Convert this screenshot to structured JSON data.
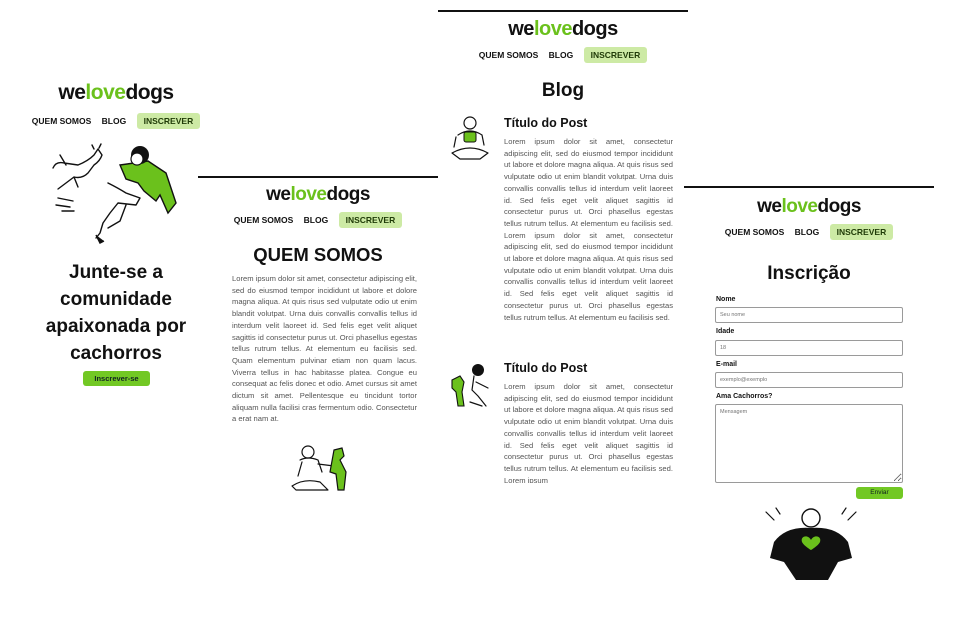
{
  "brand": {
    "prefix": "we",
    "accent": "love",
    "suffix": "dogs",
    "accent_color": "#6bc11c"
  },
  "nav": {
    "about": "QUEM SOMOS",
    "blog": "BLOG",
    "signup": "INSCREVER"
  },
  "home": {
    "headline": "Junte-se a comunidade apaixonada por cachorros",
    "cta": "Inscrever-se"
  },
  "about": {
    "title": "QUEM SOMOS",
    "text": "Lorem ipsum dolor sit amet, consectetur adipiscing elit, sed do eiusmod tempor incididunt ut labore et dolore magna aliqua. At quis risus sed vulputate odio ut enim blandit volutpat. Urna duis convallis convallis tellus id interdum velit laoreet id. Sed felis eget velit aliquet sagittis id consectetur purus ut. Orci phasellus egestas tellus rutrum tellus. At elementum eu facilisis sed. Quam elementum pulvinar etiam non quam lacus. Viverra tellus in hac habitasse platea. Congue eu consequat ac felis donec et odio. Amet cursus sit amet dictum sit amet. Pellentesque eu tincidunt tortor aliquam nulla facilisi cras fermentum odio. Consectetur a erat nam at."
  },
  "blog": {
    "title": "Blog",
    "posts": [
      {
        "title": "Título do Post",
        "text": "Lorem ipsum dolor sit amet, consectetur adipiscing elit, sed do eiusmod tempor incididunt ut labore et dolore magna aliqua. At quis risus sed vulputate odio ut enim blandit volutpat. Urna duis convallis convallis tellus id interdum velit laoreet id. Sed felis eget velit aliquet sagittis id consectetur purus ut. Orci phasellus egestas tellus rutrum tellus. At elementum eu facilisis sed. Lorem ipsum dolor sit amet, consectetur adipiscing elit, sed do eiusmod tempor incididunt ut labore et dolore magna aliqua. At quis risus sed vulputate odio ut enim blandit volutpat. Urna duis convallis convallis tellus id interdum velit laoreet id. Sed felis eget velit aliquet sagittis id consectetur purus ut. Orci phasellus egestas tellus rutrum tellus. At elementum eu facilisis sed."
      },
      {
        "title": "Título do Post",
        "text": "Lorem ipsum dolor sit amet, consectetur adipiscing elit, sed do eiusmod tempor incididunt ut labore et dolore magna aliqua. At quis risus sed vulputate odio ut enim blandit volutpat. Urna duis convallis convallis tellus id interdum velit laoreet id. Sed felis eget velit aliquet sagittis id consectetur purus ut. Orci phasellus egestas tellus rutrum tellus. At elementum eu facilisis sed. Lorem ipsum"
      }
    ]
  },
  "signup": {
    "title": "Inscrição",
    "name_label": "Nome",
    "name_placeholder": "Seu nome",
    "age_label": "Idade",
    "age_placeholder": "18",
    "email_label": "E-mail",
    "email_placeholder": "exemplo@exemplo",
    "dogs_label": "Ama Cachorros?",
    "dogs_placeholder": "Mensagem",
    "submit": "Enviar"
  }
}
